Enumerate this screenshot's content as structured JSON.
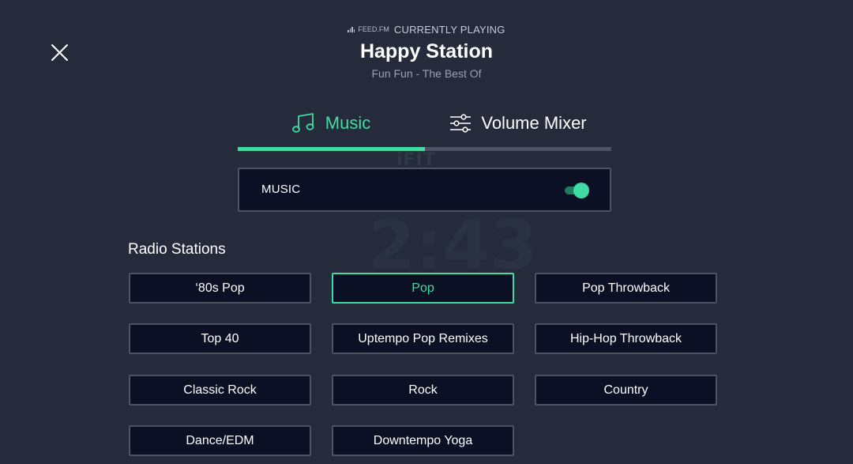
{
  "now_playing": {
    "brand": "FEED.FM",
    "label": "CURRENTLY PLAYING",
    "station": "Happy Station",
    "track": "Fun Fun - The Best Of"
  },
  "background": {
    "logo": "iFIT",
    "timer": "2:43"
  },
  "icons": {
    "close": "close-icon",
    "music": "music-note-icon",
    "mixer": "sliders-icon",
    "feed": "equalizer-bars-icon"
  },
  "tabs": [
    {
      "label": "Music",
      "active": true
    },
    {
      "label": "Volume Mixer",
      "active": false
    }
  ],
  "music_toggle": {
    "label": "MUSIC",
    "enabled": true
  },
  "radio": {
    "title": "Radio Stations",
    "stations": [
      {
        "label": "‘80s Pop",
        "selected": false
      },
      {
        "label": "Pop",
        "selected": true
      },
      {
        "label": "Pop Throwback",
        "selected": false
      },
      {
        "label": "Top 40",
        "selected": false
      },
      {
        "label": "Uptempo Pop Remixes",
        "selected": false
      },
      {
        "label": "Hip-Hop Throwback",
        "selected": false
      },
      {
        "label": "Classic Rock",
        "selected": false
      },
      {
        "label": "Rock",
        "selected": false
      },
      {
        "label": "Country",
        "selected": false
      },
      {
        "label": "Dance/EDM",
        "selected": false
      },
      {
        "label": "Downtempo Yoga",
        "selected": false
      }
    ]
  },
  "colors": {
    "background": "#252b3b",
    "accent": "#3fdda4",
    "panel": "#0b1024",
    "border": "#4d5363"
  }
}
